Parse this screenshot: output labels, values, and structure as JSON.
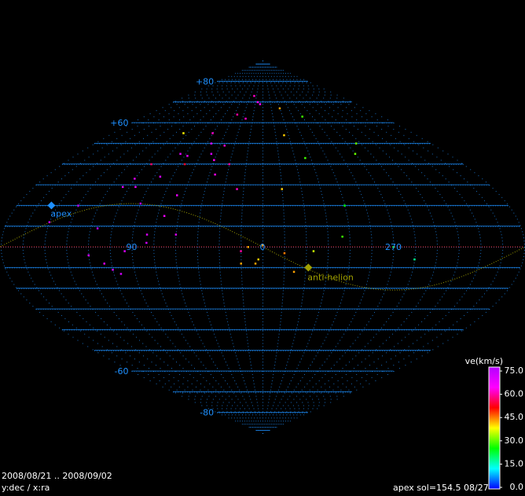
{
  "chart_data": {
    "type": "scatter",
    "projection": "sinusoidal sky map",
    "x_axis": {
      "label_text": "ra",
      "center_value": 0,
      "tick_labels": [
        "90",
        "0",
        "270"
      ]
    },
    "y_axis": {
      "label_text": "dec",
      "range": [
        -90,
        90
      ],
      "tick_labels": [
        "+80",
        "+60",
        "-60",
        "-80"
      ]
    },
    "markers": [
      {
        "label": "apex",
        "ra": 154.5,
        "dec": 20,
        "color": "#1e90ff"
      },
      {
        "label": "anti-helion",
        "ra": 328,
        "dec": -10,
        "color": "#a0a000"
      }
    ],
    "colorbar": {
      "title": "ve(km/s)",
      "ticks": [
        "75.0",
        "60.0",
        "45.0",
        "30.0",
        "15.0",
        "0.0"
      ],
      "range": [
        0,
        75
      ]
    },
    "points": [
      {
        "ra": 20,
        "dec": 73,
        "v": 60
      },
      {
        "ra": 10,
        "dec": 70,
        "v": 62
      },
      {
        "ra": 5,
        "dec": 69,
        "v": 64
      },
      {
        "ra": 40,
        "dec": 64,
        "v": 58
      },
      {
        "ra": 25,
        "dec": 62,
        "v": 60
      },
      {
        "ra": 95,
        "dec": 55,
        "v": 38
      },
      {
        "ra": 60,
        "dec": 55,
        "v": 60
      },
      {
        "ra": 55,
        "dec": 50,
        "v": 70
      },
      {
        "ra": 40,
        "dec": 49,
        "v": 60
      },
      {
        "ra": 80,
        "dec": 45,
        "v": 68
      },
      {
        "ra": 72,
        "dec": 44,
        "v": 66
      },
      {
        "ra": 50,
        "dec": 45,
        "v": 70
      },
      {
        "ra": 45,
        "dec": 42,
        "v": 62
      },
      {
        "ra": 30,
        "dec": 40,
        "v": 58
      },
      {
        "ra": 70,
        "dec": 40,
        "v": 52
      },
      {
        "ra": 100,
        "dec": 40,
        "v": 55
      },
      {
        "ra": 85,
        "dec": 34,
        "v": 70
      },
      {
        "ra": 40,
        "dec": 35,
        "v": 62
      },
      {
        "ra": 105,
        "dec": 33,
        "v": 68
      },
      {
        "ra": 20,
        "dec": 28,
        "v": 60
      },
      {
        "ra": 100,
        "dec": 29,
        "v": 66
      },
      {
        "ra": 110,
        "dec": 29,
        "v": 68
      },
      {
        "ra": 65,
        "dec": 25,
        "v": 65
      },
      {
        "ra": 90,
        "dec": 21,
        "v": 74
      },
      {
        "ra": 135,
        "dec": 20,
        "v": 74
      },
      {
        "ra": 70,
        "dec": 15,
        "v": 64
      },
      {
        "ra": 150,
        "dec": 12,
        "v": 72
      },
      {
        "ra": 115,
        "dec": 9,
        "v": 74
      },
      {
        "ra": 80,
        "dec": 6,
        "v": 68
      },
      {
        "ra": 60,
        "dec": 6,
        "v": 68
      },
      {
        "ra": 80,
        "dec": 2,
        "v": 70
      },
      {
        "ra": 15,
        "dec": -2,
        "v": 58
      },
      {
        "ra": 95,
        "dec": -2,
        "v": 68
      },
      {
        "ra": 10,
        "dec": 0,
        "v": 42
      },
      {
        "ra": 0,
        "dec": 1,
        "v": 42
      },
      {
        "ra": 120,
        "dec": -4,
        "v": 70
      },
      {
        "ra": 110,
        "dec": -8,
        "v": 68
      },
      {
        "ra": 105,
        "dec": -11,
        "v": 70
      },
      {
        "ra": 100,
        "dec": -13,
        "v": 70
      },
      {
        "ra": 15,
        "dec": -8,
        "v": 42
      },
      {
        "ra": 5,
        "dec": -8,
        "v": 42
      },
      {
        "ra": 3,
        "dec": -6,
        "v": 40
      },
      {
        "ra": 345,
        "dec": -3,
        "v": 44
      },
      {
        "ra": 335,
        "dec": 54,
        "v": 40
      },
      {
        "ra": 330,
        "dec": 67,
        "v": 42
      },
      {
        "ra": 300,
        "dec": 63,
        "v": 28
      },
      {
        "ra": 260,
        "dec": 50,
        "v": 30
      },
      {
        "ra": 270,
        "dec": 45,
        "v": 30
      },
      {
        "ra": 320,
        "dec": 43,
        "v": 28
      },
      {
        "ra": 345,
        "dec": 28,
        "v": 40
      },
      {
        "ra": 300,
        "dec": 20,
        "v": 25
      },
      {
        "ra": 305,
        "dec": 5,
        "v": 28
      },
      {
        "ra": 270,
        "dec": 0,
        "v": 25
      },
      {
        "ra": 255,
        "dec": -6,
        "v": 18
      },
      {
        "ra": 325,
        "dec": -2,
        "v": 35
      },
      {
        "ra": 338,
        "dec": -12,
        "v": 42
      }
    ]
  },
  "footer": {
    "date_range": "2008/08/21 .. 2008/09/02",
    "axes_note": "y:dec / x:ra",
    "apex_info": "apex sol=154.5 08/27"
  },
  "colors": {
    "background": "#000000",
    "grid": "#1e90ff",
    "ecliptic": "#a0a000",
    "equator": "#ff2020"
  }
}
